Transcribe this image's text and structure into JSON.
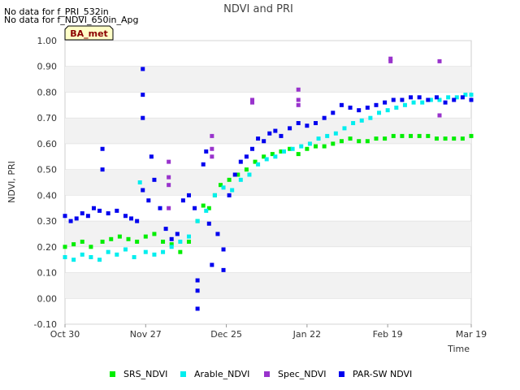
{
  "notes": [
    "No data for f_PRI_532in",
    "No data for f_NDVI_650in_Apg"
  ],
  "badge": "BA_met",
  "chart_data": {
    "type": "scatter",
    "title": "NDVI and PRI",
    "xlabel": "Time",
    "ylabel": "NDVI, PRI",
    "x_axis_type": "date",
    "x_range": [
      "2023-10-30",
      "2024-03-19"
    ],
    "x_ticks": [
      {
        "date": "2023-10-30",
        "label": "Oct 30"
      },
      {
        "date": "2023-11-27",
        "label": "Nov 27"
      },
      {
        "date": "2023-12-25",
        "label": "Dec 25"
      },
      {
        "date": "2024-01-22",
        "label": "Jan 22"
      },
      {
        "date": "2024-02-19",
        "label": "Feb 19"
      },
      {
        "date": "2024-03-19",
        "label": "Mar 19"
      }
    ],
    "ylim": [
      -0.1,
      1.0
    ],
    "y_ticks": [
      "-0.10",
      "0.00",
      "0.10",
      "0.20",
      "0.30",
      "0.40",
      "0.50",
      "0.60",
      "0.70",
      "0.80",
      "0.90",
      "1.00"
    ],
    "grid": "horizontal bands",
    "legend_position": "bottom",
    "series": [
      {
        "name": "SRS_NDVI",
        "color": "#00ee00",
        "points": [
          [
            "2023-10-30",
            0.2
          ],
          [
            "2023-11-02",
            0.21
          ],
          [
            "2023-11-05",
            0.22
          ],
          [
            "2023-11-08",
            0.2
          ],
          [
            "2023-11-12",
            0.22
          ],
          [
            "2023-11-15",
            0.23
          ],
          [
            "2023-11-18",
            0.24
          ],
          [
            "2023-11-21",
            0.23
          ],
          [
            "2023-11-24",
            0.22
          ],
          [
            "2023-11-27",
            0.24
          ],
          [
            "2023-11-30",
            0.25
          ],
          [
            "2023-12-03",
            0.22
          ],
          [
            "2023-12-06",
            0.21
          ],
          [
            "2023-12-09",
            0.18
          ],
          [
            "2023-12-12",
            0.22
          ],
          [
            "2023-12-15",
            0.3
          ],
          [
            "2023-12-17",
            0.36
          ],
          [
            "2023-12-19",
            0.35
          ],
          [
            "2023-12-21",
            0.4
          ],
          [
            "2023-12-23",
            0.44
          ],
          [
            "2023-12-26",
            0.46
          ],
          [
            "2023-12-29",
            0.48
          ],
          [
            "2024-01-01",
            0.5
          ],
          [
            "2024-01-04",
            0.53
          ],
          [
            "2024-01-07",
            0.55
          ],
          [
            "2024-01-10",
            0.56
          ],
          [
            "2024-01-13",
            0.57
          ],
          [
            "2024-01-16",
            0.58
          ],
          [
            "2024-01-19",
            0.56
          ],
          [
            "2024-01-22",
            0.58
          ],
          [
            "2024-01-25",
            0.59
          ],
          [
            "2024-01-28",
            0.59
          ],
          [
            "2024-01-31",
            0.6
          ],
          [
            "2024-02-03",
            0.61
          ],
          [
            "2024-02-06",
            0.62
          ],
          [
            "2024-02-09",
            0.61
          ],
          [
            "2024-02-12",
            0.61
          ],
          [
            "2024-02-15",
            0.62
          ],
          [
            "2024-02-18",
            0.62
          ],
          [
            "2024-02-21",
            0.63
          ],
          [
            "2024-02-24",
            0.63
          ],
          [
            "2024-02-27",
            0.63
          ],
          [
            "2024-03-01",
            0.63
          ],
          [
            "2024-03-04",
            0.63
          ],
          [
            "2024-03-07",
            0.62
          ],
          [
            "2024-03-10",
            0.62
          ],
          [
            "2024-03-13",
            0.62
          ],
          [
            "2024-03-16",
            0.62
          ],
          [
            "2024-03-19",
            0.63
          ]
        ]
      },
      {
        "name": "Arable_NDVI",
        "color": "#00eeee",
        "points": [
          [
            "2023-10-30",
            0.16
          ],
          [
            "2023-11-02",
            0.15
          ],
          [
            "2023-11-05",
            0.17
          ],
          [
            "2023-11-08",
            0.16
          ],
          [
            "2023-11-11",
            0.15
          ],
          [
            "2023-11-14",
            0.18
          ],
          [
            "2023-11-17",
            0.17
          ],
          [
            "2023-11-20",
            0.19
          ],
          [
            "2023-11-23",
            0.16
          ],
          [
            "2023-11-25",
            0.45
          ],
          [
            "2023-11-27",
            0.18
          ],
          [
            "2023-11-30",
            0.17
          ],
          [
            "2023-12-03",
            0.18
          ],
          [
            "2023-12-06",
            0.2
          ],
          [
            "2023-12-09",
            0.22
          ],
          [
            "2023-12-12",
            0.24
          ],
          [
            "2023-12-15",
            0.3
          ],
          [
            "2023-12-18",
            0.34
          ],
          [
            "2023-12-21",
            0.4
          ],
          [
            "2023-12-24",
            0.43
          ],
          [
            "2023-12-27",
            0.42
          ],
          [
            "2023-12-30",
            0.46
          ],
          [
            "2024-01-02",
            0.48
          ],
          [
            "2024-01-05",
            0.52
          ],
          [
            "2024-01-08",
            0.54
          ],
          [
            "2024-01-11",
            0.55
          ],
          [
            "2024-01-14",
            0.57
          ],
          [
            "2024-01-17",
            0.58
          ],
          [
            "2024-01-20",
            0.59
          ],
          [
            "2024-01-23",
            0.6
          ],
          [
            "2024-01-26",
            0.62
          ],
          [
            "2024-01-29",
            0.63
          ],
          [
            "2024-02-01",
            0.64
          ],
          [
            "2024-02-04",
            0.66
          ],
          [
            "2024-02-07",
            0.68
          ],
          [
            "2024-02-10",
            0.69
          ],
          [
            "2024-02-13",
            0.7
          ],
          [
            "2024-02-16",
            0.72
          ],
          [
            "2024-02-19",
            0.73
          ],
          [
            "2024-02-22",
            0.74
          ],
          [
            "2024-02-25",
            0.75
          ],
          [
            "2024-02-28",
            0.76
          ],
          [
            "2024-03-02",
            0.76
          ],
          [
            "2024-03-05",
            0.77
          ],
          [
            "2024-03-08",
            0.77
          ],
          [
            "2024-03-11",
            0.78
          ],
          [
            "2024-03-14",
            0.78
          ],
          [
            "2024-03-17",
            0.79
          ],
          [
            "2024-03-19",
            0.79
          ]
        ]
      },
      {
        "name": "Spec_NDVI",
        "color": "#9933cc",
        "points": [
          [
            "2023-12-05",
            0.53
          ],
          [
            "2023-12-05",
            0.47
          ],
          [
            "2023-12-05",
            0.44
          ],
          [
            "2023-12-05",
            0.35
          ],
          [
            "2023-12-20",
            0.63
          ],
          [
            "2023-12-20",
            0.58
          ],
          [
            "2023-12-20",
            0.55
          ],
          [
            "2024-01-03",
            0.77
          ],
          [
            "2024-01-03",
            0.76
          ],
          [
            "2024-01-19",
            0.81
          ],
          [
            "2024-01-19",
            0.77
          ],
          [
            "2024-01-19",
            0.75
          ],
          [
            "2024-02-20",
            0.93
          ],
          [
            "2024-02-20",
            0.92
          ],
          [
            "2024-03-08",
            0.92
          ],
          [
            "2024-03-08",
            0.71
          ]
        ]
      },
      {
        "name": "PAR-SW NDVI",
        "color": "#0000ee",
        "points": [
          [
            "2023-10-30",
            0.32
          ],
          [
            "2023-11-01",
            0.3
          ],
          [
            "2023-11-03",
            0.31
          ],
          [
            "2023-11-05",
            0.33
          ],
          [
            "2023-11-07",
            0.32
          ],
          [
            "2023-11-09",
            0.35
          ],
          [
            "2023-11-11",
            0.34
          ],
          [
            "2023-11-12",
            0.58
          ],
          [
            "2023-11-12",
            0.5
          ],
          [
            "2023-11-14",
            0.33
          ],
          [
            "2023-11-17",
            0.34
          ],
          [
            "2023-11-20",
            0.32
          ],
          [
            "2023-11-22",
            0.31
          ],
          [
            "2023-11-24",
            0.3
          ],
          [
            "2023-11-26",
            0.42
          ],
          [
            "2023-11-26",
            0.89
          ],
          [
            "2023-11-26",
            0.79
          ],
          [
            "2023-11-26",
            0.7
          ],
          [
            "2023-11-28",
            0.38
          ],
          [
            "2023-11-29",
            0.55
          ],
          [
            "2023-11-30",
            0.46
          ],
          [
            "2023-12-02",
            0.35
          ],
          [
            "2023-12-04",
            0.27
          ],
          [
            "2023-12-06",
            0.23
          ],
          [
            "2023-12-08",
            0.25
          ],
          [
            "2023-12-10",
            0.38
          ],
          [
            "2023-12-12",
            0.4
          ],
          [
            "2023-12-14",
            0.35
          ],
          [
            "2023-12-15",
            0.07
          ],
          [
            "2023-12-15",
            0.03
          ],
          [
            "2023-12-15",
            -0.04
          ],
          [
            "2023-12-17",
            0.52
          ],
          [
            "2023-12-18",
            0.57
          ],
          [
            "2023-12-19",
            0.29
          ],
          [
            "2023-12-20",
            0.13
          ],
          [
            "2023-12-22",
            0.25
          ],
          [
            "2023-12-24",
            0.19
          ],
          [
            "2023-12-24",
            0.11
          ],
          [
            "2023-12-26",
            0.4
          ],
          [
            "2023-12-28",
            0.48
          ],
          [
            "2023-12-30",
            0.53
          ],
          [
            "2024-01-01",
            0.55
          ],
          [
            "2024-01-03",
            0.58
          ],
          [
            "2024-01-05",
            0.62
          ],
          [
            "2024-01-07",
            0.61
          ],
          [
            "2024-01-09",
            0.64
          ],
          [
            "2024-01-11",
            0.65
          ],
          [
            "2024-01-13",
            0.63
          ],
          [
            "2024-01-16",
            0.66
          ],
          [
            "2024-01-19",
            0.68
          ],
          [
            "2024-01-22",
            0.67
          ],
          [
            "2024-01-25",
            0.68
          ],
          [
            "2024-01-28",
            0.7
          ],
          [
            "2024-01-31",
            0.72
          ],
          [
            "2024-02-03",
            0.75
          ],
          [
            "2024-02-06",
            0.74
          ],
          [
            "2024-02-09",
            0.73
          ],
          [
            "2024-02-12",
            0.74
          ],
          [
            "2024-02-15",
            0.75
          ],
          [
            "2024-02-18",
            0.76
          ],
          [
            "2024-02-21",
            0.77
          ],
          [
            "2024-02-24",
            0.77
          ],
          [
            "2024-02-27",
            0.78
          ],
          [
            "2024-03-01",
            0.78
          ],
          [
            "2024-03-04",
            0.77
          ],
          [
            "2024-03-07",
            0.78
          ],
          [
            "2024-03-10",
            0.76
          ],
          [
            "2024-03-13",
            0.77
          ],
          [
            "2024-03-16",
            0.78
          ],
          [
            "2024-03-19",
            0.77
          ]
        ]
      }
    ]
  }
}
